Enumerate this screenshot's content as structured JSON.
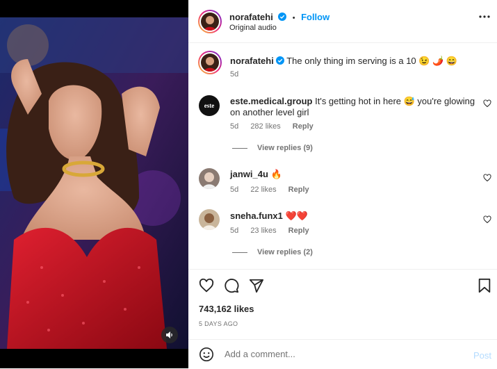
{
  "post": {
    "username": "norafatehi",
    "follow_label": "Follow",
    "separator": "•",
    "audio": "Original audio",
    "caption": "The only thing im serving is a 10 😉 🌶️ 😄",
    "caption_age": "5d",
    "likes": "743,162 likes",
    "date": "5 DAYS AGO"
  },
  "comments": [
    {
      "username": "este.medical.group",
      "text": "It's getting hot in here 😅 you're glowing on another level girl",
      "age": "5d",
      "likes": "282 likes",
      "reply": "Reply",
      "view_replies": "View replies (9)",
      "avatar_text": "este"
    },
    {
      "username": "janwi_4u",
      "text": "🔥",
      "age": "5d",
      "likes": "22 likes",
      "reply": "Reply"
    },
    {
      "username": "sneha.funx1",
      "text": "❤️❤️",
      "age": "5d",
      "likes": "23 likes",
      "reply": "Reply",
      "view_replies": "View replies (2)"
    }
  ],
  "composer": {
    "placeholder": "Add a comment...",
    "post_label": "Post"
  },
  "colors": {
    "accent": "#0095f6",
    "verified": "#0095f6",
    "muted": "#737373",
    "dress": "#c8101c"
  },
  "icons": [
    "more-icon",
    "verified-icon",
    "heart-icon",
    "comment-icon",
    "share-icon",
    "bookmark-icon",
    "emoji-icon",
    "mute-icon"
  ]
}
